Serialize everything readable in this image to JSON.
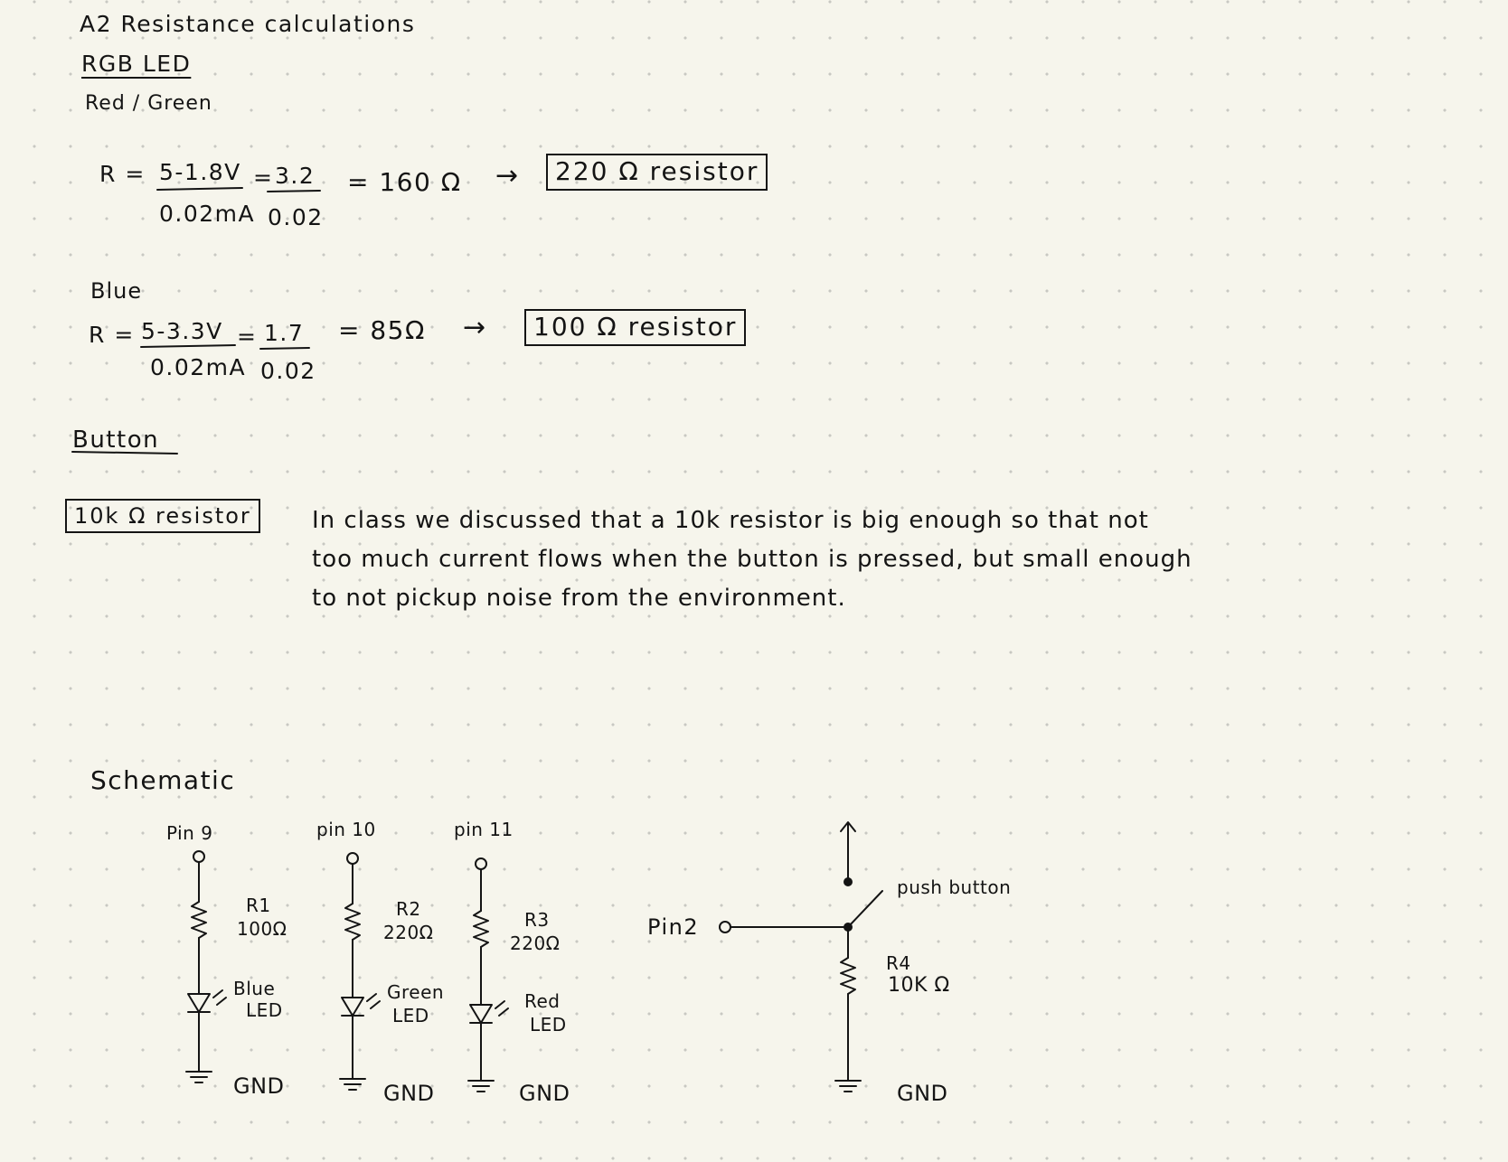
{
  "title": "A2 Resistance calculations",
  "rgb_heading": "RGB LED",
  "red_green": {
    "heading": "Red / Green",
    "r_label": "R =",
    "numerator": "5-1.8V",
    "equals_a": "=",
    "simplified_numerator": "3.2",
    "denominator": "0.02mA",
    "simplified_denominator": "0.02",
    "result": "= 160 Ω",
    "arrow": "→",
    "chosen": "220 Ω resistor"
  },
  "blue": {
    "heading": "Blue",
    "r_label": "R =",
    "numerator": "5-3.3V",
    "equals_a": "=",
    "simplified_numerator": "1.7",
    "denominator": "0.02mA",
    "simplified_denominator": "0.02",
    "result": "= 85Ω",
    "arrow": "→",
    "chosen": "100 Ω resistor"
  },
  "button": {
    "heading": "Button",
    "chosen": "10k Ω resistor",
    "explanation_lines": [
      "In class we discussed that a 10k resistor is big enough so that not",
      "too much current flows when the button is pressed, but small enough",
      "to not pickup noise from the environment."
    ]
  },
  "schematic": {
    "heading": "Schematic",
    "branches": [
      {
        "pin": "Pin 9",
        "resistor": "R1",
        "value": "100Ω",
        "led": [
          "Blue",
          "LED"
        ],
        "gnd": "GND"
      },
      {
        "pin": "pin 10",
        "resistor": "R2",
        "value": "220Ω",
        "led": [
          "Green",
          "LED"
        ],
        "gnd": "GND"
      },
      {
        "pin": "pin 11",
        "resistor": "R3",
        "value": "220Ω",
        "led": [
          "Red",
          "LED"
        ],
        "gnd": "GND"
      }
    ],
    "button_circuit": {
      "pin": "Pin2",
      "switch_label": "push button",
      "resistor": "R4",
      "value": "10K Ω",
      "gnd": "GND"
    }
  }
}
